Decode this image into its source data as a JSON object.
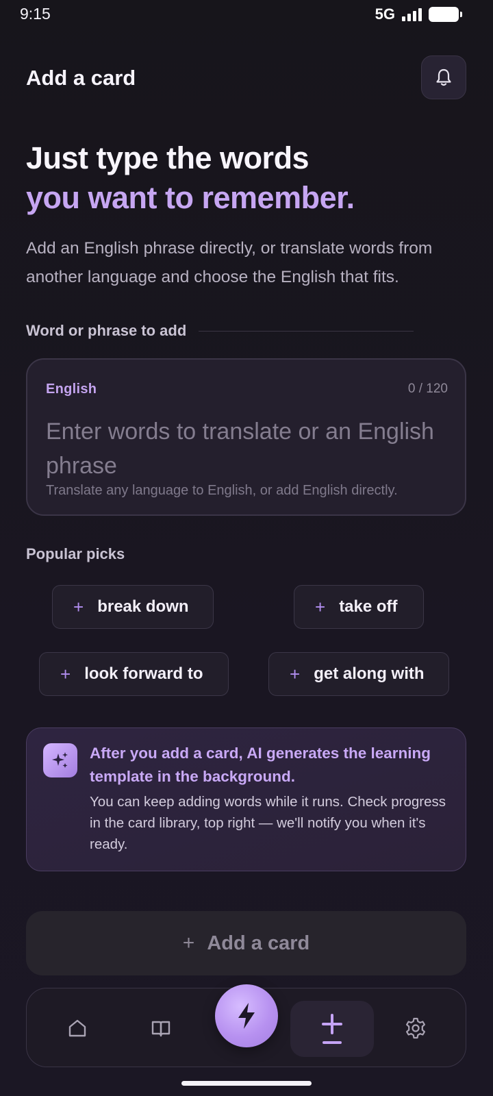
{
  "status_bar": {
    "time": "9:15",
    "network": "5G"
  },
  "header": {
    "title": "Add a card"
  },
  "hero": {
    "line1": "Just type the words",
    "line2": "you want to remember.",
    "description": "Add an English phrase directly, or translate words from another language and choose the English that fits."
  },
  "input_section": {
    "label": "Word or phrase to add",
    "language": "English",
    "char_count": "0 / 120",
    "placeholder": "Enter words to translate or an English phrase",
    "hint": "Translate any language to English, or add English directly."
  },
  "popular_picks": {
    "label": "Popular picks",
    "items": [
      {
        "label": "break down"
      },
      {
        "label": "take off"
      },
      {
        "label": "look forward to"
      },
      {
        "label": "get along with"
      }
    ]
  },
  "info_card": {
    "title": "After you add a card, AI generates the learning template in the background.",
    "body": "You can keep adding words while it runs. Check progress in the card library, top right — we'll notify you when it's ready."
  },
  "add_button": {
    "label": "Add a card"
  },
  "bottom_nav": {
    "items": [
      {
        "icon": "home-icon"
      },
      {
        "icon": "book-icon"
      },
      {
        "icon": "lightning-icon"
      },
      {
        "icon": "plus-icon",
        "active": true
      },
      {
        "icon": "gear-icon"
      }
    ]
  },
  "colors": {
    "accent": "#c6a6f2",
    "background": "#17141d"
  }
}
